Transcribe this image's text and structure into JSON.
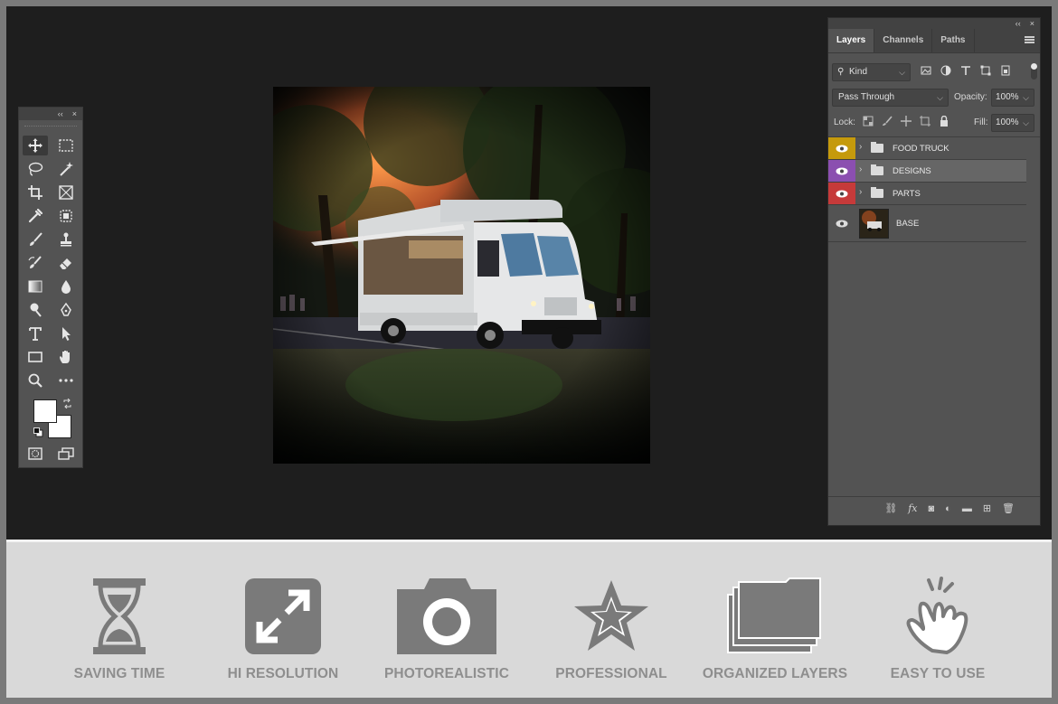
{
  "toolbar": {
    "collapse_glyph": "‹‹",
    "close_glyph": "×",
    "tools": [
      {
        "icon": "move-icon"
      },
      {
        "icon": "marquee-icon"
      },
      {
        "icon": "lasso-icon"
      },
      {
        "icon": "magic-wand-icon"
      },
      {
        "icon": "crop-icon"
      },
      {
        "icon": "frame-icon"
      },
      {
        "icon": "eyedropper-icon"
      },
      {
        "icon": "patch-icon"
      },
      {
        "icon": "brush-icon"
      },
      {
        "icon": "stamp-icon"
      },
      {
        "icon": "history-brush-icon"
      },
      {
        "icon": "eraser-icon"
      },
      {
        "icon": "gradient-icon"
      },
      {
        "icon": "blur-icon"
      },
      {
        "icon": "dodge-icon"
      },
      {
        "icon": "pen-icon"
      },
      {
        "icon": "type-icon"
      },
      {
        "icon": "path-select-icon"
      },
      {
        "icon": "rectangle-icon"
      },
      {
        "icon": "hand-icon"
      },
      {
        "icon": "zoom-icon"
      },
      {
        "icon": "more-icon"
      }
    ]
  },
  "panel": {
    "collapse_glyph": "‹‹",
    "close_glyph": "×",
    "tabs": [
      "Layers",
      "Channels",
      "Paths"
    ],
    "filter_label": "Kind",
    "blend_mode": "Pass Through",
    "opacity_label": "Opacity:",
    "opacity_value": "100%",
    "lock_label": "Lock:",
    "fill_label": "Fill:",
    "fill_value": "100%",
    "layers": [
      {
        "name": "FOOD TRUCK",
        "type": "group",
        "color": "#c59a0c"
      },
      {
        "name": "DESIGNS",
        "type": "group",
        "color": "#8b4fb0"
      },
      {
        "name": "PARTS",
        "type": "group",
        "color": "#c63a3a"
      },
      {
        "name": "BASE",
        "type": "image",
        "color": ""
      }
    ]
  },
  "features": [
    {
      "label": "SAVING TIME",
      "icon": "hourglass-icon"
    },
    {
      "label": "HI RESOLUTION",
      "icon": "expand-icon"
    },
    {
      "label": "PHOTOREALISTIC",
      "icon": "camera-icon"
    },
    {
      "label": "PROFESSIONAL",
      "icon": "star-icon"
    },
    {
      "label": "ORGANIZED LAYERS",
      "icon": "layers-icon"
    },
    {
      "label": "EASY TO USE",
      "icon": "hand-click-icon"
    }
  ],
  "colors": {
    "workspace": "#1e1e1e",
    "panel": "#535353",
    "feature_icon": "#7a7a7a",
    "feature_label": "#8e8e8e"
  }
}
